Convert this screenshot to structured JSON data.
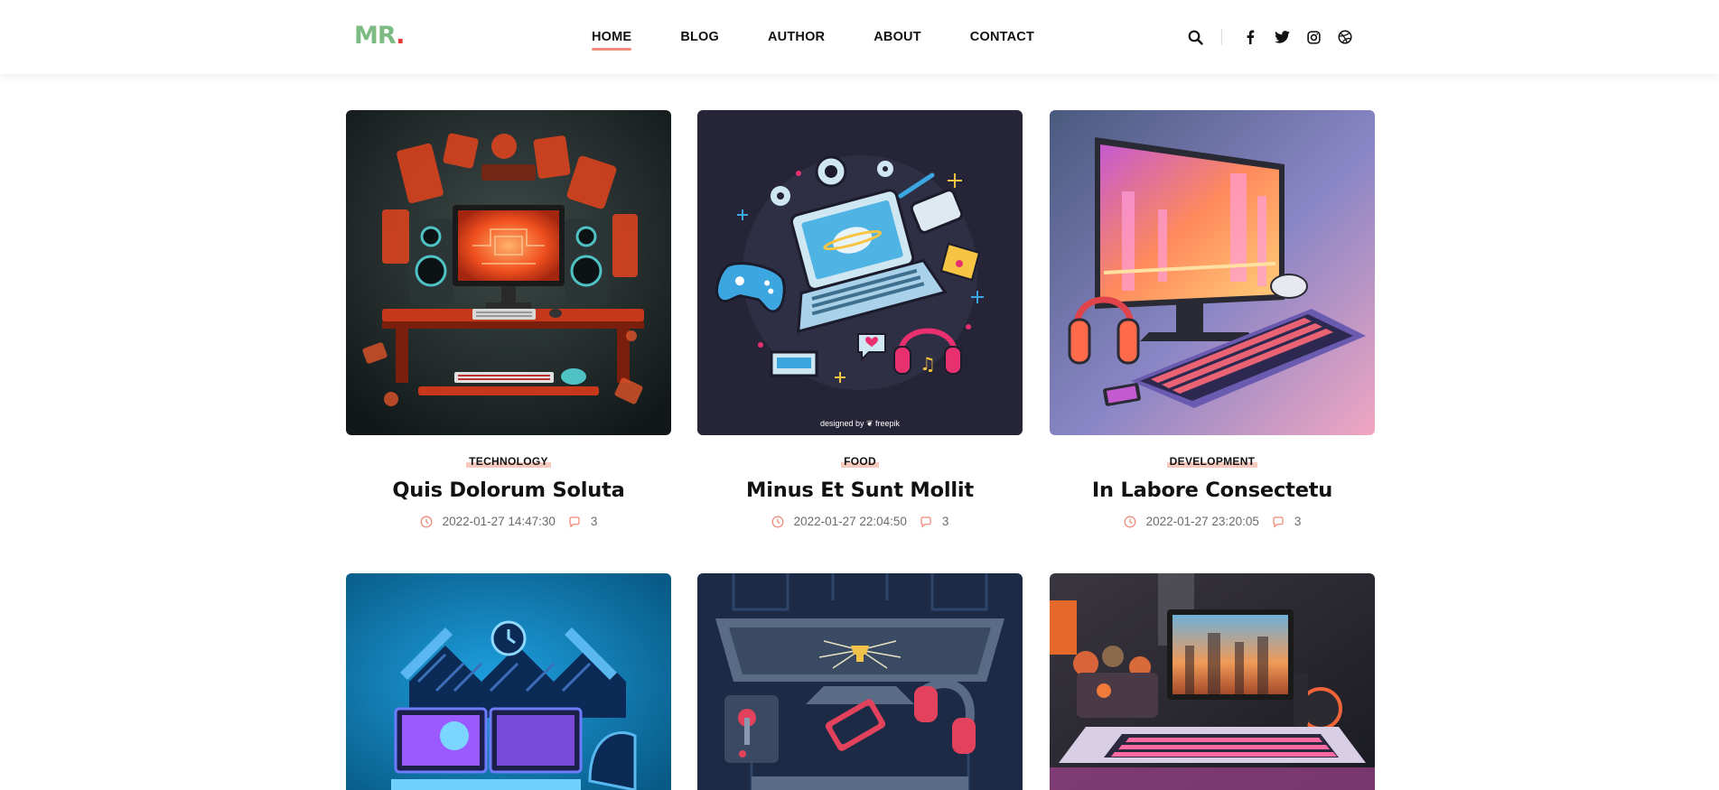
{
  "brand": {
    "logo_text": "MR",
    "logo_dot": ".",
    "color": "#7cbb83",
    "dot_color": "#e53935"
  },
  "nav": {
    "items": [
      {
        "label": "HOME",
        "active": true
      },
      {
        "label": "BLOG",
        "active": false
      },
      {
        "label": "AUTHOR",
        "active": false
      },
      {
        "label": "ABOUT",
        "active": false
      },
      {
        "label": "CONTACT",
        "active": false
      }
    ],
    "accent": "#f08b79"
  },
  "tools": {
    "icons": [
      "search-icon",
      "facebook-icon",
      "twitter-icon",
      "instagram-icon",
      "dribbble-icon"
    ]
  },
  "posts": [
    {
      "category": "TECHNOLOGY",
      "title": "Quis Dolorum Soluta",
      "date": "2022-01-27 14:47:30",
      "comments": "3",
      "image": "orange gaming desk illustration"
    },
    {
      "category": "FOOD",
      "title": "Minus Et Sunt Mollit",
      "date": "2022-01-27 22:04:50",
      "comments": "3",
      "image": "laptop and gadgets illustration",
      "watermark": "designed by ❦ freepik"
    },
    {
      "category": "DEVELOPMENT",
      "title": "In Labore Consectetu",
      "date": "2022-01-27 23:20:05",
      "comments": "3",
      "image": "neon monitor and keyboard"
    },
    {
      "image": "blue gaming setup illustration"
    },
    {
      "image": "dark monitor with trophy illustration"
    },
    {
      "image": "gaming room with city monitor"
    }
  ],
  "colors": {
    "meta_icon": "#f08b79",
    "category_highlight": "#f6c9bf"
  }
}
